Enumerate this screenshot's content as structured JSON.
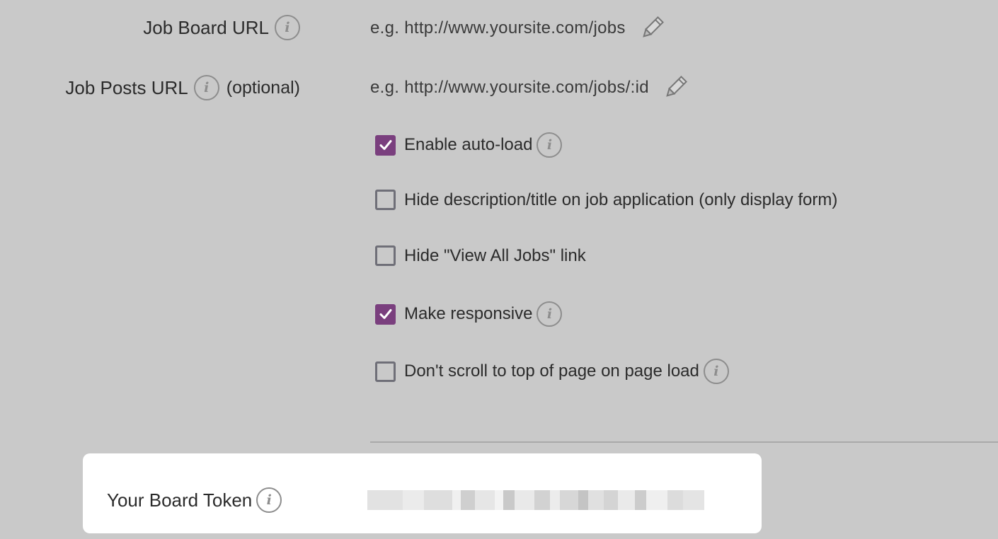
{
  "job_board_url": {
    "label": "Job Board URL",
    "placeholder": "e.g. http://www.yoursite.com/jobs",
    "info_icon": "info-icon",
    "edit_icon": "pencil-icon"
  },
  "job_posts_url": {
    "label": "Job Posts URL",
    "optional_text": "(optional)",
    "placeholder": "e.g. http://www.yoursite.com/jobs/:id",
    "info_icon": "info-icon",
    "edit_icon": "pencil-icon"
  },
  "options": [
    {
      "label": "Enable auto-load",
      "checked": true,
      "has_info": true
    },
    {
      "label": "Hide description/title on job application (only display form)",
      "checked": false,
      "has_info": false
    },
    {
      "label": "Hide \"View All Jobs\" link",
      "checked": false,
      "has_info": false
    },
    {
      "label": "Make responsive",
      "checked": true,
      "has_info": true
    },
    {
      "label": "Don't scroll to top of page on page load",
      "checked": false,
      "has_info": true
    }
  ],
  "board_token": {
    "label": "Your Board Token",
    "info_icon": "info-icon",
    "value_state": "redacted"
  },
  "colors": {
    "background": "#c9c9c9",
    "checkbox_accent": "#7a3f7e",
    "card": "#ffffff"
  },
  "info_glyph": "i"
}
